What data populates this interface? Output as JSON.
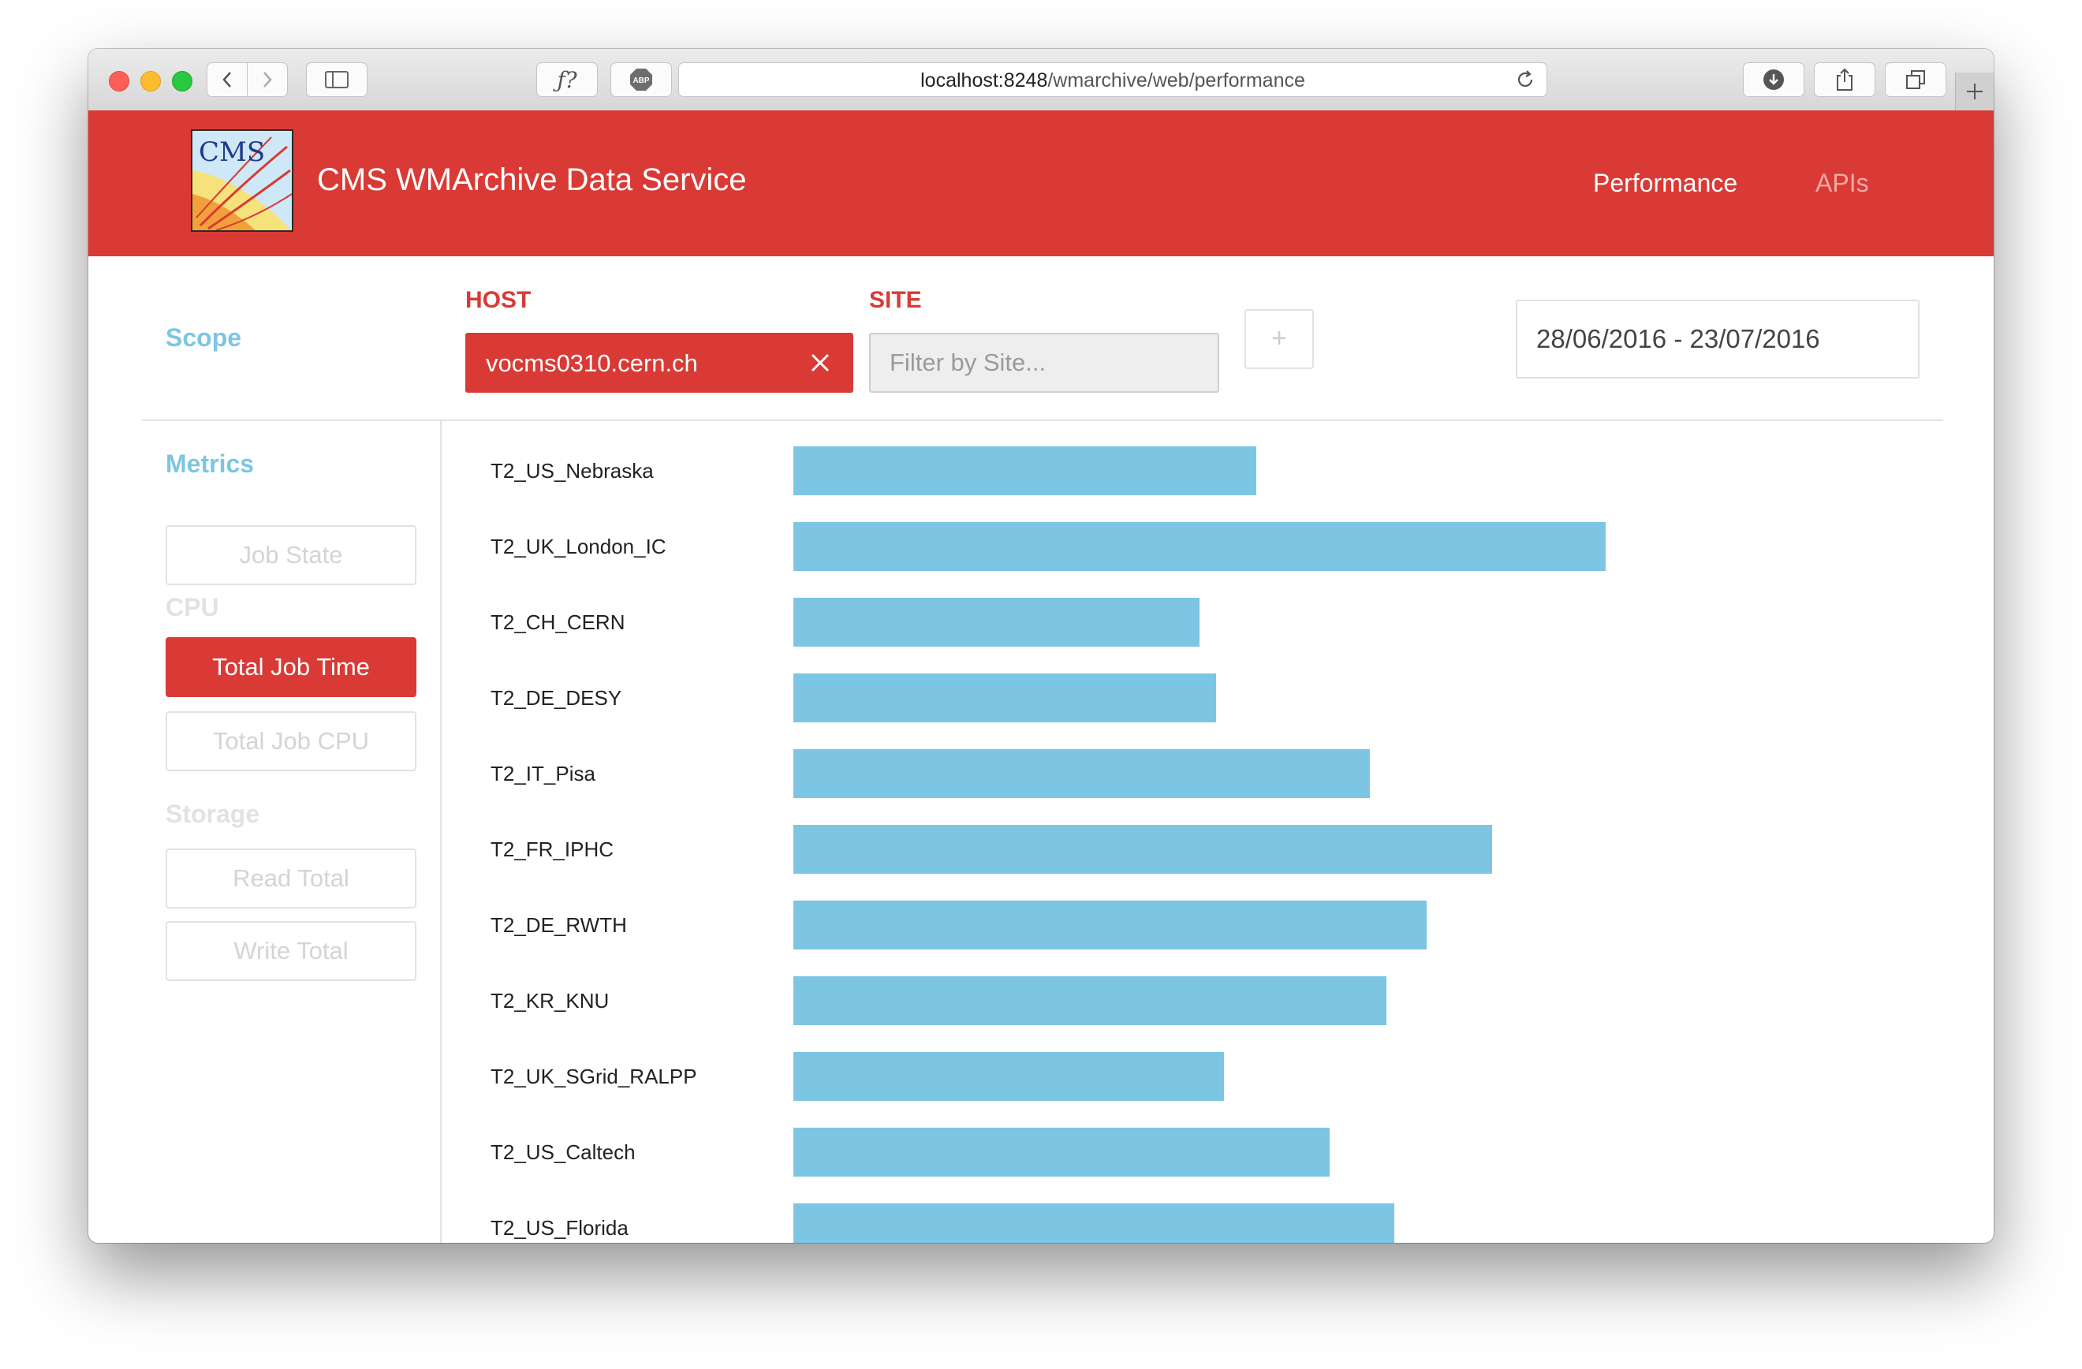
{
  "browser": {
    "url_host": "localhost:8248",
    "url_path": "/wmarchive/web/performance"
  },
  "header": {
    "logo_text": "CMS",
    "title": "CMS WMArchive Data Service",
    "nav": [
      {
        "label": "Performance",
        "active": true
      },
      {
        "label": "APIs",
        "active": false
      }
    ]
  },
  "scope": {
    "label": "Scope",
    "host_label": "HOST",
    "host_value": "vocms0310.cern.ch",
    "site_label": "SITE",
    "site_placeholder": "Filter by Site...",
    "add_label": "+",
    "date_range": "28/06/2016 - 23/07/2016"
  },
  "metrics": {
    "label": "Metrics",
    "job_state": "Job State",
    "cpu_label": "CPU",
    "total_job_time": "Total Job Time",
    "total_job_cpu": "Total Job CPU",
    "storage_label": "Storage",
    "read_total": "Read Total",
    "write_total": "Write Total",
    "active": "Total Job Time"
  },
  "colors": {
    "brand_red": "#d93a35",
    "accent_blue": "#7cc6e3"
  },
  "chart_data": {
    "type": "bar",
    "orientation": "horizontal",
    "categories": [
      "T2_US_Nebraska",
      "T2_UK_London_IC",
      "T2_CH_CERN",
      "T2_DE_DESY",
      "T2_IT_Pisa",
      "T2_FR_IPHC",
      "T2_DE_RWTH",
      "T2_KR_KNU",
      "T2_UK_SGrid_RALPP",
      "T2_US_Caltech",
      "T2_US_Florida"
    ],
    "values": [
      0.57,
      1.0,
      0.5,
      0.52,
      0.71,
      0.86,
      0.78,
      0.73,
      0.53,
      0.66,
      0.74
    ],
    "color": "#7cc6e3"
  }
}
